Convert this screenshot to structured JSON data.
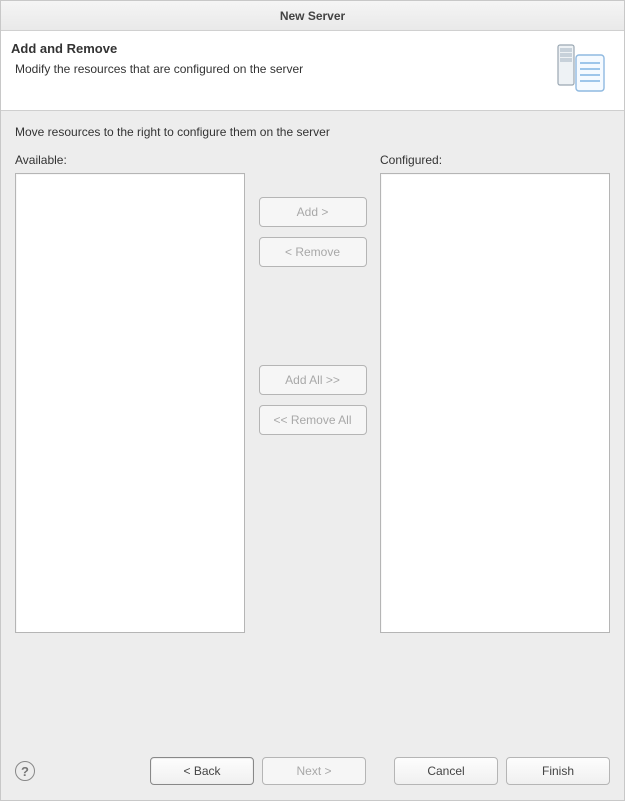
{
  "title": "New Server",
  "header": {
    "title": "Add and Remove",
    "description": "Modify the resources that are configured on the server"
  },
  "instruction": "Move resources to the right to configure them on the server",
  "labels": {
    "available": "Available:",
    "configured": "Configured:"
  },
  "buttons": {
    "add": "Add >",
    "remove": "< Remove",
    "addAll": "Add All >>",
    "removeAll": "<< Remove All",
    "back": "< Back",
    "next": "Next >",
    "cancel": "Cancel",
    "finish": "Finish"
  },
  "lists": {
    "available": [],
    "configured": []
  }
}
